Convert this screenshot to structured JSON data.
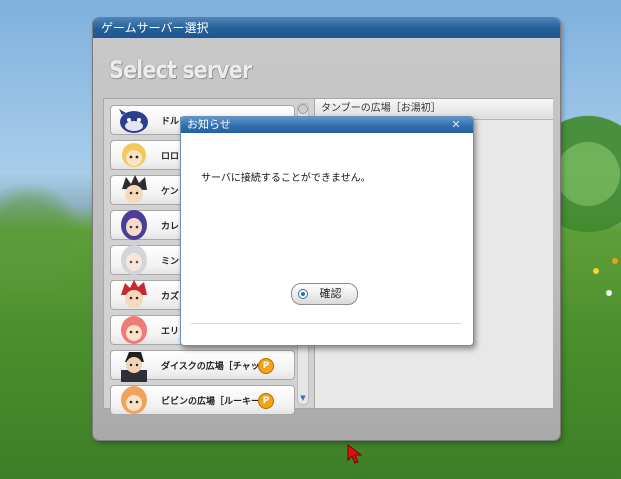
{
  "window": {
    "title": "ゲームサーバー選択",
    "heading": "Select server"
  },
  "server_list": {
    "items": [
      {
        "label": "ドルフ",
        "avatar": "dolphin-avatar",
        "badge": ""
      },
      {
        "label": "ロロ",
        "avatar": "blonde-girl-avatar",
        "badge": ""
      },
      {
        "label": "ケン",
        "avatar": "spiky-hair-boy-avatar",
        "badge": ""
      },
      {
        "label": "カレン",
        "avatar": "purple-hair-girl-avatar",
        "badge": ""
      },
      {
        "label": "ミンテ",
        "avatar": "silver-hair-girl-avatar",
        "badge": ""
      },
      {
        "label": "カズ",
        "avatar": "red-hair-boy-avatar",
        "badge": ""
      },
      {
        "label": "エリ",
        "avatar": "pink-hair-girl-avatar",
        "badge": ""
      },
      {
        "label": "ダイスクの広場［チャット］",
        "avatar": "suit-man-avatar",
        "badge": "P"
      },
      {
        "label": "ビビンの広場［ルーキー］",
        "avatar": "orange-hair-girl-avatar",
        "badge": "P"
      }
    ]
  },
  "detail": {
    "header": "タンブーの広場［お湯初］"
  },
  "dialog": {
    "title": "お知らせ",
    "close_icon": "close-icon",
    "message": "サーバに接続することができません。",
    "confirm_label": "確認"
  },
  "colors": {
    "title_blue": "#245f99",
    "badge_orange": "#f2a318",
    "cursor_red": "#e01010"
  }
}
